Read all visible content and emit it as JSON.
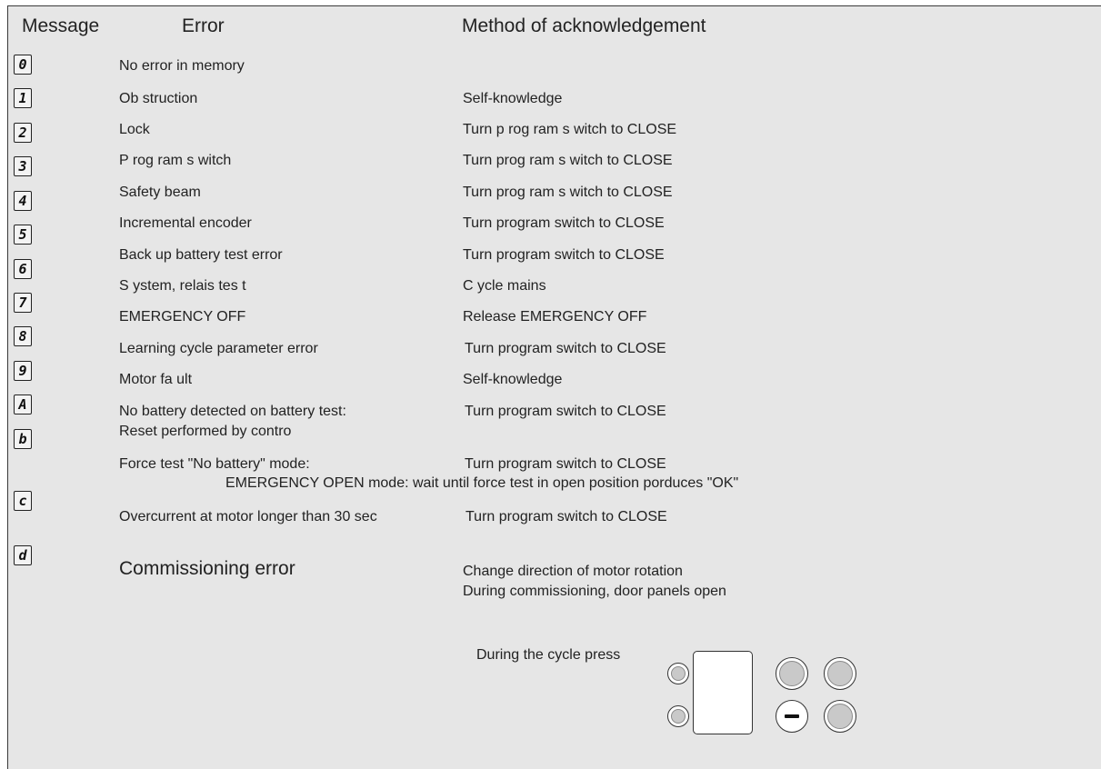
{
  "header": {
    "message": "Message",
    "error": "Error",
    "method": "Method of acknowledgement"
  },
  "glyphs": [
    "0",
    "1",
    "2",
    "3",
    "4",
    "5",
    "6",
    "7",
    "8",
    "9",
    "A",
    "b",
    "c",
    "d"
  ],
  "rows": [
    {
      "error": "No error in memory",
      "method": ""
    },
    {
      "error": "Ob struction",
      "method": "Self-knowledge"
    },
    {
      "error": "Lock",
      "method": "Turn p rog ram s witch to CLOSE"
    },
    {
      "error": "P rog ram s witch",
      "method": "Turn prog ram s witch to CLOSE"
    },
    {
      "error": "Safety beam",
      "method": "Turn prog ram s witch to CLOSE"
    },
    {
      "error": "Incremental encoder",
      "method": "Turn program switch to CLOSE"
    },
    {
      "error": "Back up battery test error",
      "method": "Turn program switch to CLOSE"
    },
    {
      "error": "S ystem, relais tes t",
      "method": "C ycle mains"
    },
    {
      "error": "EMERGENCY OFF",
      "method": "Release EMERGENCY OFF"
    },
    {
      "error": "Learning cycle parameter error",
      "method": "Turn program switch to CLOSE"
    },
    {
      "error": "Motor fa ult",
      "method": "Self-knowledge"
    },
    {
      "error": "No battery detected on battery test:",
      "error_line2": "Reset performed by contro",
      "method": "Turn program switch to CLOSE"
    },
    {
      "error": "Force test   \"No battery\" mode:",
      "method": "Turn program switch to CLOSE",
      "extra": "EMERGENCY OPEN mode: wait until force test in open position porduces \"OK\""
    },
    {
      "error": "Overcurrent at motor longer than 30 sec",
      "method": "Turn program switch to CLOSE"
    }
  ],
  "commissioning": {
    "error": "Commissioning error",
    "method_line1": "Change direction of motor rotation",
    "method_line2": "During commissioning, door panels open"
  },
  "keypad": {
    "label": "During the cycle press"
  }
}
